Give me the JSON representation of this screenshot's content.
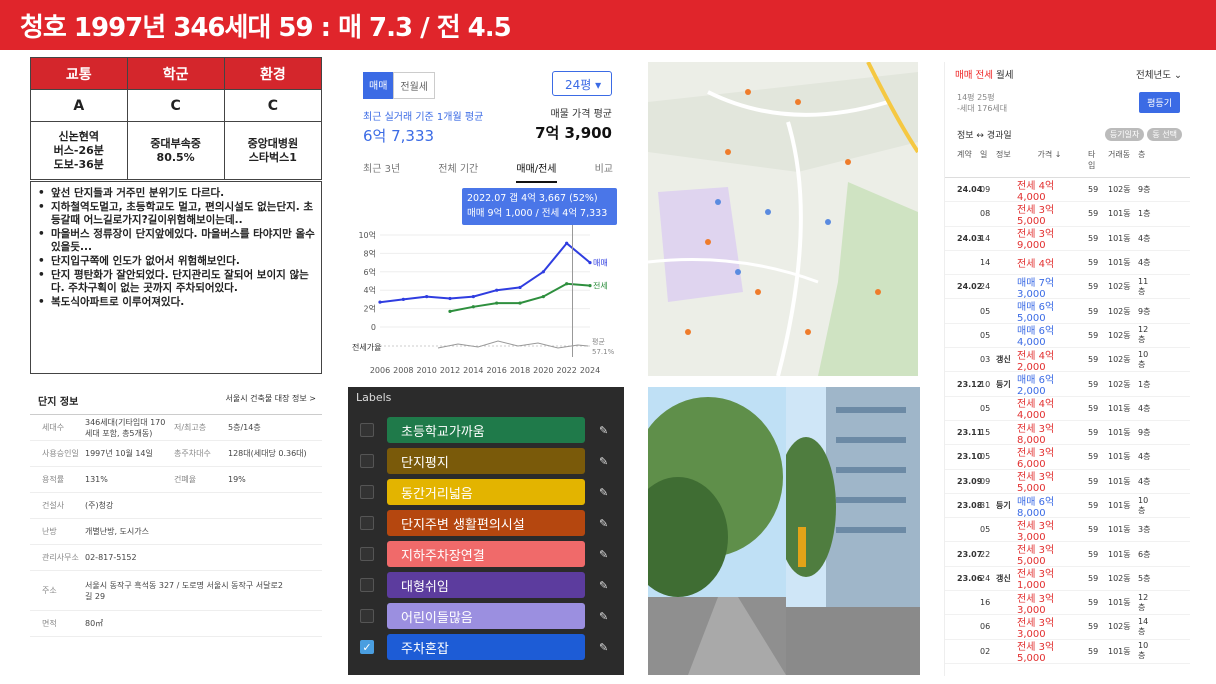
{
  "title": "청호 1997년 346세대 59 : 매 7.3 / 전 4.5",
  "grades": {
    "headers": [
      "교통",
      "학군",
      "환경"
    ],
    "values": [
      "A",
      "C",
      "C"
    ],
    "details": [
      [
        "신논현역",
        "버스-26분",
        "도보-36분"
      ],
      [
        "중대부속중",
        "80.5%"
      ],
      [
        "중앙대병원",
        "스타벅스1"
      ]
    ]
  },
  "notes": [
    "앞선 단지들과 거주민 분위기도 다르다.",
    "지하철역도멀고, 초등학교도 멀고, 편의시설도 없는단지. 초등갈때 어느길로가지?길이위험해보이는데..",
    "마을버스 정류장이 단지앞에있다. 마을버스를 타야지만 올수있을듯...",
    "단지입구쪽에 인도가 없어서 위험해보인다.",
    "단지 평탄화가 잘안되었다. 단지관리도 잘되어 보이지 않는다. 주차구획이 없는 곳까지 주차되어있다.",
    "복도식아파트로 이루어져있다."
  ],
  "info": {
    "header": "단지 정보",
    "link": "서울시 건축물 대장 정보 >",
    "rows": [
      {
        "k": "세대수",
        "v": "346세대(기타임대 170세대 포함, 총5개동)",
        "k2": "저/최고층",
        "v2": "5층/14층"
      },
      {
        "k": "사용승인일",
        "v": "1997년 10월 14일",
        "k2": "총주차대수",
        "v2": "128대(세대당 0.36대)"
      },
      {
        "k": "용적률",
        "v": "131%",
        "k2": "건폐율",
        "v2": "19%"
      },
      {
        "k": "건설사",
        "v": "(주)청강",
        "k2": "",
        "v2": ""
      },
      {
        "k": "난방",
        "v": "개별난방, 도시가스",
        "k2": "",
        "v2": ""
      },
      {
        "k": "관리사무소",
        "v": "02-817-5152",
        "k2": "",
        "v2": ""
      },
      {
        "k": "주소",
        "v": "서울시 동작구 흑석동 327 / 도로명 서울시 동작구 서달로2길 29",
        "k2": "",
        "v2": ""
      },
      {
        "k": "면적",
        "v": "80㎡",
        "k2": "",
        "v2": ""
      }
    ]
  },
  "price": {
    "tab_buy": "매매",
    "tab_rent": "전월세",
    "area_select": "24평",
    "recent_label": "최근 실거래 기준 1개월 평균",
    "recent_value": "6억 7,333",
    "listing_label": "매물 가격 평균",
    "listing_value": "7억 3,900",
    "period_tabs": [
      "최근 3년",
      "전체 기간",
      "매매/전세",
      "비교"
    ],
    "tooltip_line1": "2022.07  갭 4억 3,667 (52%)",
    "tooltip_line2": "매매 9억 1,000 / 전세 4억 7,333"
  },
  "chart_data": {
    "type": "line",
    "x": [
      2006,
      2008,
      2010,
      2012,
      2014,
      2016,
      2018,
      2020,
      2022,
      2024
    ],
    "series": [
      {
        "name": "매매",
        "values": [
          2.7,
          3.0,
          3.3,
          3.1,
          3.3,
          4.0,
          4.3,
          6.0,
          9.1,
          7.0
        ]
      },
      {
        "name": "전세",
        "values": [
          null,
          null,
          null,
          1.7,
          2.2,
          2.6,
          2.6,
          3.3,
          4.7,
          4.5
        ]
      }
    ],
    "yticks": [
      "10억",
      "8억",
      "6억",
      "4억",
      "2억",
      "0"
    ],
    "xticks": [
      "2006",
      "2008",
      "2010",
      "2012",
      "2014",
      "2016",
      "2018",
      "2020",
      "2022",
      "2024"
    ],
    "ratio_label": "전세가율",
    "ratio_value_label": "평균",
    "ratio_value": "57.1%"
  },
  "labels": {
    "header": "Labels",
    "items": [
      {
        "text": "초등학교가까움",
        "color": "#1f7a4a",
        "checked": false
      },
      {
        "text": "단지평지",
        "color": "#7a5a0a",
        "checked": false
      },
      {
        "text": "동간거리넓음",
        "color": "#e3b400",
        "checked": false
      },
      {
        "text": "단지주변 생활편의시설",
        "color": "#b5470f",
        "checked": false
      },
      {
        "text": "지하주차장연결",
        "color": "#f06a6a",
        "checked": false
      },
      {
        "text": "대형쉬임",
        "color": "#5c3c9e",
        "checked": false
      },
      {
        "text": "어린이들많음",
        "color": "#9b8fe0",
        "checked": false
      },
      {
        "text": "주차혼잡",
        "color": "#1d5cd6",
        "checked": true
      }
    ]
  },
  "tx": {
    "tabs": [
      "매매",
      "전세",
      "월세"
    ],
    "year_select": "전체년도",
    "area_line1": "14평  25평",
    "area_line2": "-세대  176세대",
    "btn": "평등기",
    "filter_left": "정보 ↔ 경과일",
    "chip1": "등기일자",
    "chip2": "동 선택",
    "headers": [
      "계약",
      "일",
      "정보",
      "가격 ↓",
      "타입",
      "거래동",
      "층"
    ],
    "rows": [
      [
        "24.04",
        "09",
        "",
        "전세 4억 4,000",
        "59",
        "102동",
        "9층"
      ],
      [
        "",
        "08",
        "",
        "전세 3억 5,000",
        "59",
        "101동",
        "1층"
      ],
      [
        "24.03",
        "14",
        "",
        "전세 3억 9,000",
        "59",
        "101동",
        "4층"
      ],
      [
        "",
        "14",
        "",
        "전세 4억",
        "59",
        "101동",
        "4층"
      ],
      [
        "24.02",
        "24",
        "",
        "매매 7억 3,000",
        "59",
        "102동",
        "11층"
      ],
      [
        "",
        "05",
        "",
        "매매 6억 5,000",
        "59",
        "102동",
        "9층"
      ],
      [
        "",
        "05",
        "",
        "매매 6억 4,000",
        "59",
        "102동",
        "12층"
      ],
      [
        "",
        "03",
        "갱신",
        "전세 4억 2,000",
        "59",
        "102동",
        "10층"
      ],
      [
        "23.12",
        "10",
        "등기",
        "매매 6억 2,000",
        "59",
        "102동",
        "1층"
      ],
      [
        "",
        "05",
        "",
        "전세 4억 4,000",
        "59",
        "101동",
        "4층"
      ],
      [
        "23.11",
        "15",
        "",
        "전세 3억 8,000",
        "59",
        "101동",
        "9층"
      ],
      [
        "23.10",
        "05",
        "",
        "전세 3억 6,000",
        "59",
        "101동",
        "4층"
      ],
      [
        "23.09",
        "09",
        "",
        "전세 3억 5,000",
        "59",
        "101동",
        "4층"
      ],
      [
        "23.08",
        "31",
        "등기",
        "매매 6억 8,000",
        "59",
        "101동",
        "10층"
      ],
      [
        "",
        "05",
        "",
        "전세 3억 3,000",
        "59",
        "101동",
        "3층"
      ],
      [
        "23.07",
        "22",
        "",
        "전세 3억 5,000",
        "59",
        "101동",
        "6층"
      ],
      [
        "23.06",
        "24",
        "갱신",
        "전세 3억 1,000",
        "59",
        "102동",
        "5층"
      ],
      [
        "",
        "16",
        "",
        "전세 3억 3,000",
        "59",
        "101동",
        "12층"
      ],
      [
        "",
        "06",
        "",
        "전세 3억 3,000",
        "59",
        "102동",
        "14층"
      ],
      [
        "",
        "02",
        "",
        "전세 3억 5,000",
        "59",
        "101동",
        "10층"
      ]
    ]
  }
}
